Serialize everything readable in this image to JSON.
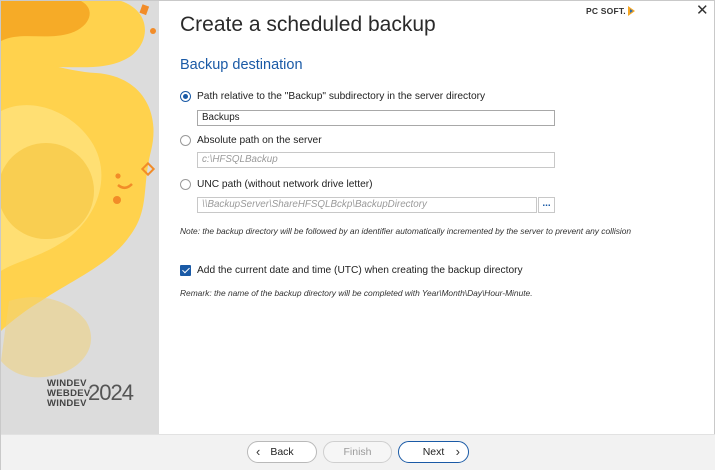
{
  "window": {
    "title": "Create a scheduled backup",
    "brand_logo": "PC SOFT.",
    "close_icon": "✕"
  },
  "side_panel": {
    "brand_lines": [
      "WINDEV",
      "WEBDEV",
      "WINDEV"
    ],
    "brand_year": "2024",
    "colors": {
      "primary": "#ffc83a",
      "accent": "#f28c28",
      "background": "#dcdcdc"
    }
  },
  "section": {
    "title": "Backup destination"
  },
  "options": {
    "relative": {
      "label": "Path relative to the \"Backup\" subdirectory in the server directory",
      "selected": true,
      "value": "Backups"
    },
    "absolute": {
      "label": "Absolute path on the server",
      "selected": false,
      "placeholder": "c:\\HFSQLBackup"
    },
    "unc": {
      "label": "UNC path (without network drive letter)",
      "selected": false,
      "placeholder": "\\\\BackupServer\\ShareHFSQLBckp\\BackupDirectory",
      "browse_label": "..."
    }
  },
  "note1": "Note: the backup directory will be followed by an identifier automatically incremented by the server to prevent any collision",
  "date_option": {
    "label": "Add the current date and time (UTC) when creating the backup directory",
    "checked": true
  },
  "remark": "Remark: the name of the backup directory will be completed with Year\\Month\\Day\\Hour-Minute.",
  "footer": {
    "back_label": "Back",
    "finish_label": "Finish",
    "next_label": "Next"
  },
  "colors": {
    "accent": "#1a5aa6"
  }
}
